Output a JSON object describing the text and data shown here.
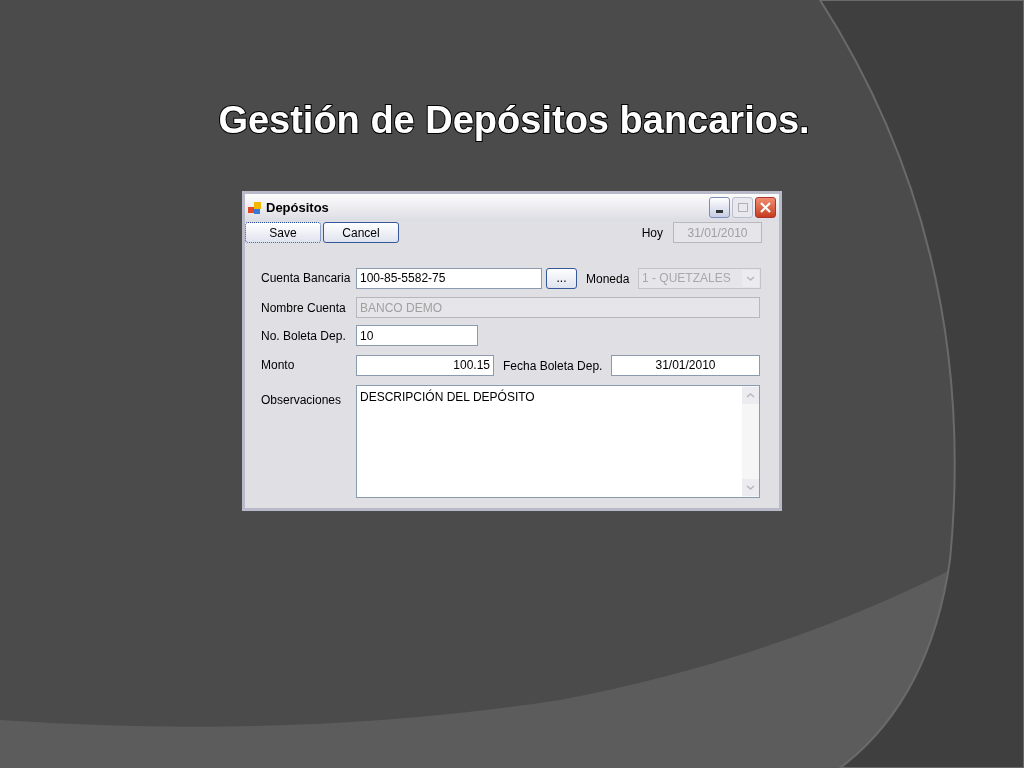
{
  "slide": {
    "title": "Gestión de Depósitos bancarios."
  },
  "window": {
    "title": "Depósitos"
  },
  "toolbar": {
    "buttons": [
      {
        "label": "Save",
        "focused": true
      },
      {
        "label": "Cancel",
        "focused": false
      }
    ],
    "today_label": "Hoy",
    "today": {
      "value": "31/01/2010",
      "disabled": true
    }
  },
  "form": {
    "account": {
      "label": "Cuenta Bancaria",
      "value": "100-85-5582-75",
      "disabled": false
    },
    "lookup_button": "...",
    "currency": {
      "label": "Moneda",
      "value": "1 - QUETZALES",
      "disabled": true
    },
    "account_name": {
      "label": "Nombre Cuenta",
      "value": "BANCO DEMO",
      "disabled": true
    },
    "slip_number": {
      "label": "No. Boleta Dep.",
      "value": "10",
      "disabled": false
    },
    "amount": {
      "label": "Monto",
      "value": "100.15",
      "disabled": false
    },
    "slip_date": {
      "label": "Fecha Boleta Dep.",
      "value": "31/01/2010",
      "disabled": false
    },
    "notes": {
      "label": "Observaciones",
      "value": "DESCRIPCIÓN DEL DEPÓSITO",
      "disabled": false
    }
  }
}
